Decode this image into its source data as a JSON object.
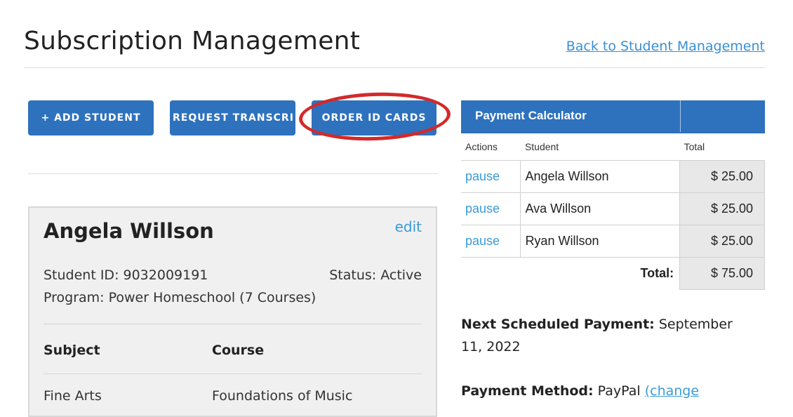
{
  "header": {
    "title": "Subscription Management",
    "back_link": "Back to Student Management"
  },
  "actions": {
    "add_student": "+ ADD STUDENT",
    "request_transcript": "REQUEST TRANSCRI",
    "order_id_cards": "ORDER ID CARDS"
  },
  "student": {
    "name": "Angela Willson",
    "edit": "edit",
    "student_id": "Student ID: 9032009191",
    "status": "Status: Active",
    "program": "Program: Power Homeschool (7 Courses)",
    "table_headers": {
      "subject": "Subject",
      "course": "Course"
    },
    "rows": [
      {
        "subject": "Fine Arts",
        "course": "Foundations of Music"
      }
    ]
  },
  "calculator": {
    "title": "Payment Calculator",
    "columns": {
      "actions": "Actions",
      "student": "Student",
      "total": "Total"
    },
    "rows": [
      {
        "action": "pause",
        "student": "Angela Willson",
        "total": "$ 25.00"
      },
      {
        "action": "pause",
        "student": "Ava Willson",
        "total": "$ 25.00"
      },
      {
        "action": "pause",
        "student": "Ryan Willson",
        "total": "$ 25.00"
      }
    ],
    "total_label": "Total:",
    "total_value": "$ 75.00"
  },
  "payment": {
    "next_label": "Next Scheduled Payment:",
    "next_value": " September 11, 2022",
    "method_label": "Payment Method:",
    "method_value": " PayPal ",
    "change_link": "(change"
  },
  "colors": {
    "accent": "#2e72bd",
    "link": "#3a9bd8",
    "highlight_circle": "#d32a2a"
  }
}
